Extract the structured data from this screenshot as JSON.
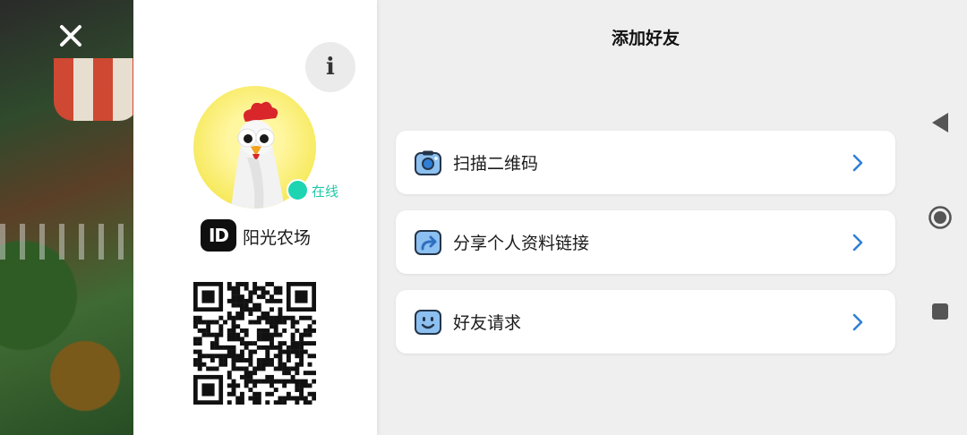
{
  "colors": {
    "accent": "#2f7fd6",
    "online": "#1fd4b1",
    "panel_bg": "#ffffff",
    "page_bg": "#efefef"
  },
  "overlay": {
    "close_icon": "close-icon"
  },
  "profile": {
    "info_label": "i",
    "online_text": "在线",
    "id_badge": "ID",
    "username": "阳光农场"
  },
  "header": {
    "title": "添加好友"
  },
  "menu": {
    "items": [
      {
        "label": "扫描二维码",
        "icon": "camera-icon"
      },
      {
        "label": "分享个人资料链接",
        "icon": "share-icon"
      },
      {
        "label": "好友请求",
        "icon": "friend-face-icon"
      }
    ]
  },
  "nav": {
    "back": "back-triangle-icon",
    "home": "home-circle-icon",
    "recents": "recents-square-icon"
  }
}
